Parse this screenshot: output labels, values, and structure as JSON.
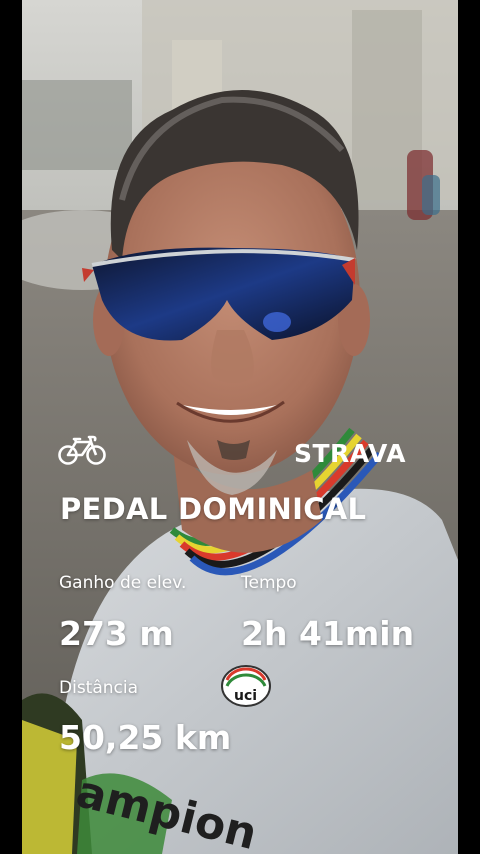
{
  "brand": {
    "logo_text": "STRAVA",
    "activity_icon": "road-bike-icon"
  },
  "activity": {
    "title": "PEDAL DOMINICAL"
  },
  "stats": {
    "elevation": {
      "label": "Ganho de elev.",
      "value": "273 m"
    },
    "time": {
      "label": "Tempo",
      "value": "2h 41min"
    },
    "distance": {
      "label": "Distância",
      "value": "50,25 km"
    }
  },
  "jersey": {
    "logo_text": "uci",
    "print_text": "ampion"
  },
  "colors": {
    "text": "#ffffff",
    "background_bars": "#000000"
  }
}
